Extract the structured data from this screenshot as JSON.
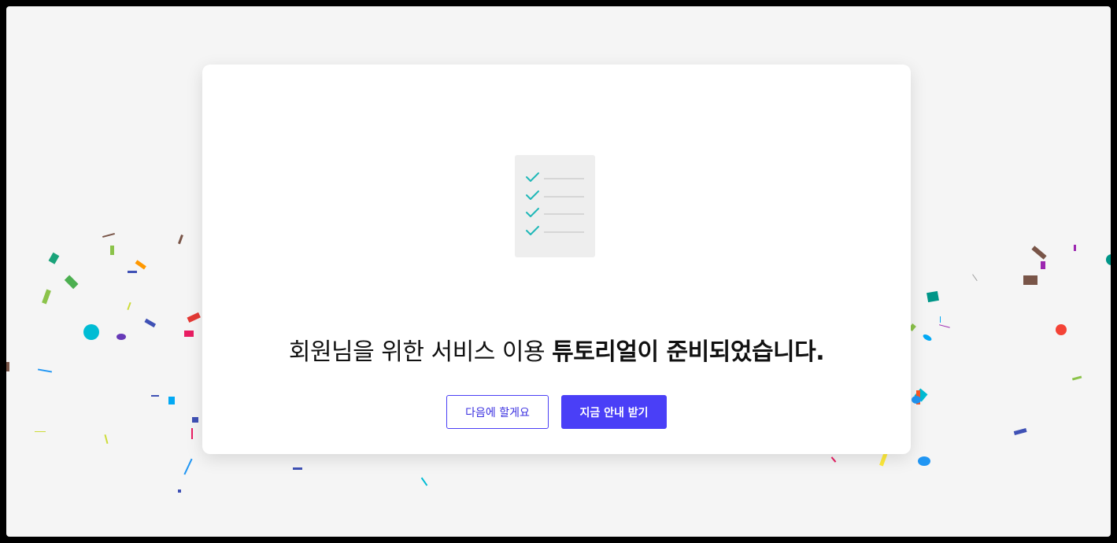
{
  "dialog": {
    "headline_regular": "회원님을 위한 서비스 이용 ",
    "headline_bold": "튜토리얼이 준비되었습니다.",
    "later_button": "다음에 할게요",
    "start_button": "지금 안내 받기"
  },
  "illustration": {
    "icon": "checklist-icon",
    "check_color": "#20b8b8",
    "checklist_rows": 4
  },
  "colors": {
    "accent": "#4a3ff7",
    "background": "#f5f5f5"
  }
}
